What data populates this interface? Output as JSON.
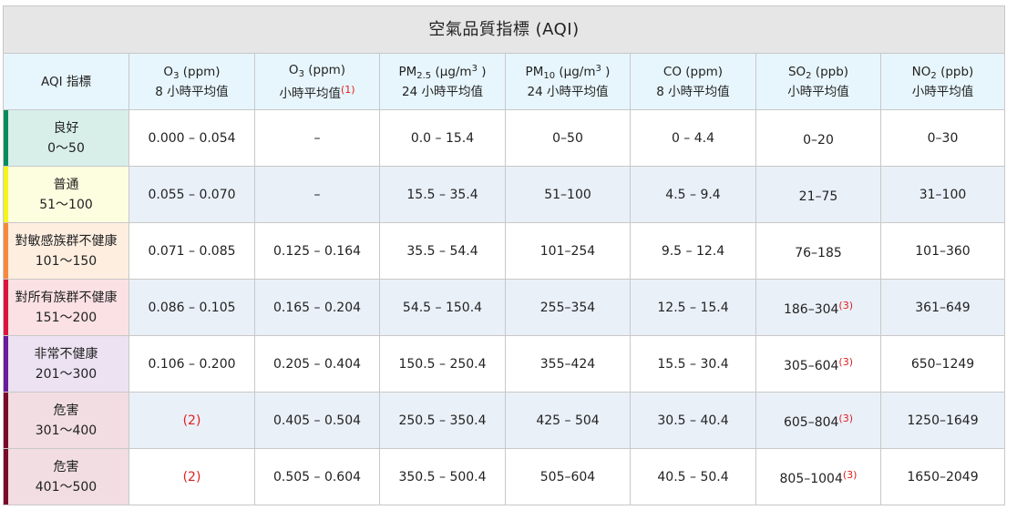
{
  "title": "空氣品質指標 (AQI)",
  "headers": {
    "aqi": "AQI 指標",
    "o3_8h": {
      "p1": "O",
      "sub": "3",
      "p2": " (ppm)",
      "line2": "8 小時平均值"
    },
    "o3_1h": {
      "p1": "O",
      "sub": "3",
      "p2": " (ppm)",
      "line2": "小時平均值",
      "note": "(1)"
    },
    "pm25": {
      "p1": "PM",
      "sub": "2.5",
      "p2": " (µg/m",
      "sup": "3",
      "p3": " )",
      "line2": "24 小時平均值"
    },
    "pm10": {
      "p1": "PM",
      "sub": "10",
      "p2": " (µg/m",
      "sup": "3",
      "p3": " )",
      "line2": "24 小時平均值"
    },
    "co": {
      "line1": "CO (ppm)",
      "line2": "8 小時平均值"
    },
    "so2": {
      "p1": "SO",
      "sub": "2",
      "p2": " (ppb)",
      "line2": "小時平均值"
    },
    "no2": {
      "p1": "NO",
      "sub": "2",
      "p2": " (ppb)",
      "line2": "小時平均值"
    }
  },
  "rows": [
    {
      "name": "良好",
      "range": "0～50",
      "color": "#0a8a5c",
      "bg": "#d8efe9",
      "o3_8h": "0.000 – 0.054",
      "o3_1h": "–",
      "pm25": "0.0 – 15.4",
      "pm10": "0–50",
      "co": "0 – 4.4",
      "so2": "0–20",
      "so2_note": "",
      "no2": "0–30"
    },
    {
      "name": "普通",
      "range": "51～100",
      "color": "#f5f51e",
      "bg": "#fdfde0",
      "o3_8h": "0.055 – 0.070",
      "o3_1h": "–",
      "pm25": "15.5 – 35.4",
      "pm10": "51–100",
      "co": "4.5 – 9.4",
      "so2": "21–75",
      "so2_note": "",
      "no2": "31–100"
    },
    {
      "name": "對敏感族群不健康",
      "range": "101～150",
      "color": "#f5893c",
      "bg": "#fdeee0",
      "o3_8h": "0.071 – 0.085",
      "o3_1h": "0.125 – 0.164",
      "pm25": "35.5 – 54.4",
      "pm10": "101–254",
      "co": "9.5 – 12.4",
      "so2": "76–185",
      "so2_note": "",
      "no2": "101–360"
    },
    {
      "name": "對所有族群不健康",
      "range": "151～200",
      "color": "#dc143c",
      "bg": "#fbe1e4",
      "o3_8h": "0.086 – 0.105",
      "o3_1h": "0.165 – 0.204",
      "pm25": "54.5 – 150.4",
      "pm10": "255–354",
      "co": "12.5 – 15.4",
      "so2": "186–304",
      "so2_note": "(3)",
      "no2": "361–649"
    },
    {
      "name": "非常不健康",
      "range": "201～300",
      "color": "#6a1b9a",
      "bg": "#ece2f2",
      "o3_8h": "0.106 – 0.200",
      "o3_1h": "0.205 – 0.404",
      "pm25": "150.5 – 250.4",
      "pm10": "355–424",
      "co": "15.5 – 30.4",
      "so2": "305–604",
      "so2_note": "(3)",
      "no2": "650–1249"
    },
    {
      "name": "危害",
      "range": "301～400",
      "color": "#7b0a2a",
      "bg": "#f1dde2",
      "o3_8h": "(2)",
      "o3_1h": "0.405 – 0.504",
      "pm25": "250.5 – 350.4",
      "pm10": "425 – 504",
      "co": "30.5 – 40.4",
      "so2": "605–804",
      "so2_note": "(3)",
      "no2": "1250–1649"
    },
    {
      "name": "危害",
      "range": "401～500",
      "color": "#7b0a2a",
      "bg": "#f1dde2",
      "o3_8h": "(2)",
      "o3_1h": "0.505 – 0.604",
      "pm25": "350.5 – 500.4",
      "pm10": "505–604",
      "co": "40.5 – 50.4",
      "so2": "805–1004",
      "so2_note": "(3)",
      "no2": "1650–2049"
    }
  ]
}
